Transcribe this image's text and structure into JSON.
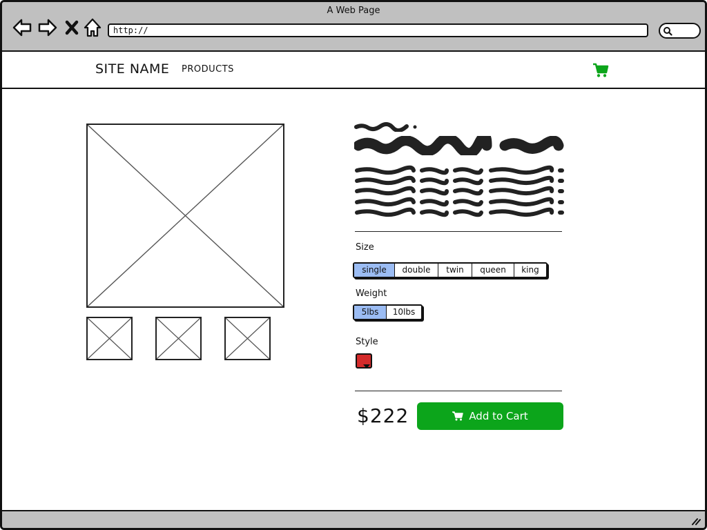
{
  "window": {
    "title": "A Web Page"
  },
  "browser": {
    "url": "http://"
  },
  "header": {
    "site_name": "SITE NAME",
    "nav_products": "PRODUCTS"
  },
  "product": {
    "size": {
      "label": "Size",
      "options": [
        "single",
        "double",
        "twin",
        "queen",
        "king"
      ],
      "selected": "single"
    },
    "weight": {
      "label": "Weight",
      "options": [
        "5lbs",
        "10lbs"
      ],
      "selected": "5lbs"
    },
    "style": {
      "label": "Style",
      "swatch_color": "#d42a2a"
    },
    "price": "$222",
    "add_to_cart_label": "Add to Cart"
  },
  "colors": {
    "chrome": "#c0c0c0",
    "accent_green": "#0ca51b",
    "selected_blue": "#9bbcf3"
  },
  "icons": {
    "back": "arrow-left-icon",
    "forward": "arrow-right-icon",
    "stop": "close-icon",
    "home": "home-icon",
    "search": "search-icon",
    "cart": "cart-icon",
    "grip": "resize-grip-icon"
  }
}
